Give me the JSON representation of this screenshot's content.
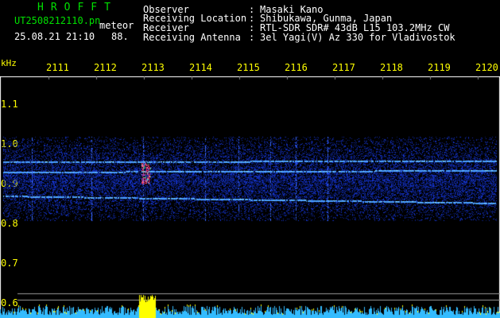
{
  "app": {
    "title": "HROFFT",
    "filename": "UT2508212110.pn",
    "mode": "meteor",
    "datetime": "25.08.21 21:10",
    "level": "88."
  },
  "station": [
    {
      "label": "Observer",
      "value": "Masaki Kano"
    },
    {
      "label": "Receiving Location",
      "value": "Shibukawa, Gunma, Japan"
    },
    {
      "label": "Receiver",
      "value": "RTL-SDR SDR# 43dB L15 103.2MHz CW"
    },
    {
      "label": "Receiving Antenna",
      "value": "3el Yagi(V) Az 330 for Vladivostok"
    }
  ],
  "axis": {
    "unit": "kHz",
    "time_ticks": [
      "2111",
      "2112",
      "2113",
      "2114",
      "2115",
      "2116",
      "2117",
      "2118",
      "2119",
      "2120"
    ],
    "freq_ticks": [
      {
        "label": "1.1",
        "value": 1.1
      },
      {
        "label": "1.0",
        "value": 1.0
      },
      {
        "label": "0.9",
        "value": 0.9
      },
      {
        "label": "0.8",
        "value": 0.8
      },
      {
        "label": "0.7",
        "value": 0.7
      },
      {
        "label": "0.6",
        "value": 0.6
      }
    ]
  },
  "colors": {
    "background": "#000000",
    "text_primary": "#ffffff",
    "text_accent": "#00e000",
    "ticks": "#ffff00",
    "noise_band": "#1a2fd6",
    "signal_line": "#4aa0ff",
    "meteor_echo": "#ff2a55",
    "level_trace": "#33bbff",
    "level_peak": "#ffff00"
  }
}
